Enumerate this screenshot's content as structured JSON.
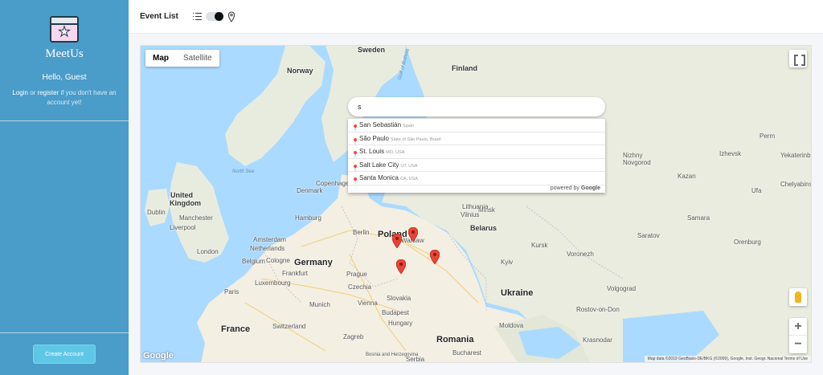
{
  "sidebar": {
    "brand": "MeetUs",
    "greeting": "Hello, Guest",
    "auth_login": "Login",
    "auth_or": " or ",
    "auth_register": "register",
    "auth_suffix": " if you don't have an account yet!",
    "create_account": "Create Account",
    "color": "#4a9cc9"
  },
  "header": {
    "title": "Event List",
    "view_toggle": "map"
  },
  "map": {
    "tabs": [
      {
        "label": "Map",
        "active": true
      },
      {
        "label": "Satellite",
        "active": false
      }
    ],
    "search_value": "s",
    "suggestions": [
      {
        "main": "San Sebastián",
        "secondary": "Spain"
      },
      {
        "main": "São Paulo",
        "secondary": "State of São Paulo, Brazil"
      },
      {
        "main": "St. Louis",
        "secondary": "MO, USA"
      },
      {
        "main": "Salt Lake City",
        "secondary": "UT, USA"
      },
      {
        "main": "Santa Monica",
        "secondary": "CA, USA"
      }
    ],
    "powered_by": "powered by",
    "powered_brand": "Google",
    "logo": "Google",
    "copyright": "Map data ©2019 GeoBasis-DE/BKG (©2009), Google, Inst. Geogr. Nacional    Terms of Use",
    "labels": {
      "sweden": "Sweden",
      "norway": "Norway",
      "finland": "Finland",
      "north_sea": "North Sea",
      "gulf": "Gulf of Bothnia",
      "denmark": "Denmark",
      "copenhagen": "Copenhagen",
      "uk": "United Kingdom",
      "dublin": "Dublin",
      "manchester": "Manchester",
      "liverpool": "Liverpool",
      "london": "London",
      "hamburg": "Hamburg",
      "berlin": "Berlin",
      "netherlands": "Netherlands",
      "amsterdam": "Amsterdam",
      "cologne": "Cologne",
      "germany": "Germany",
      "belgium": "Belgium",
      "frankfurt": "Frankfurt",
      "luxembourg": "Luxembourg",
      "paris": "Paris",
      "france": "France",
      "czechia": "Czechia",
      "prague": "Prague",
      "munich": "Munich",
      "vienna": "Vienna",
      "switzerland": "Switzerland",
      "poland": "Poland",
      "warsaw": "Warsaw",
      "belarus": "Belarus",
      "minsk": "Minsk",
      "slovakia": "Slovakia",
      "hungary": "Hungary",
      "budapest": "Budapest",
      "ukraine": "Ukraine",
      "kyiv": "Kyiv",
      "moldova": "Moldova",
      "romania": "Romania",
      "bucharest": "Bucharest",
      "bosnia": "Bosnia and Herzegovina",
      "serbia": "Serbia",
      "zagreb": "Zagreb",
      "lithuania": "Lithuania",
      "vilnius": "Vilnius",
      "voronezh": "Voronezh",
      "kursk": "Kursk",
      "saratov": "Saratov",
      "samara": "Samara",
      "volgograd": "Volgograd",
      "rostov": "Rostov-on-Don",
      "krasnodar": "Krasnodar",
      "kazan": "Kazan",
      "nizhny": "Nizhny Novgorod",
      "yekaterinburg": "Yekaterinburg",
      "chelyabinsk": "Chelyabinsk",
      "ufa": "Ufa",
      "orenburg": "Orenburg",
      "perm": "Perm",
      "izhevsk": "Izhevsk"
    }
  }
}
